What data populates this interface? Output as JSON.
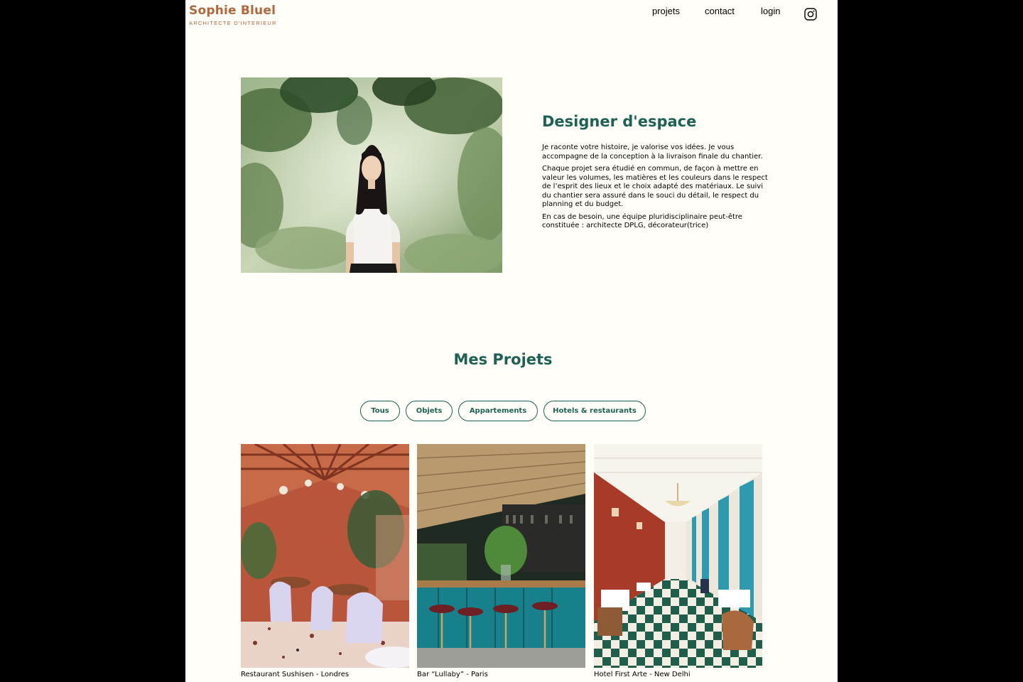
{
  "header": {
    "logo_title": "Sophie Bluel",
    "logo_subtitle": "ARCHITECTE D'INTERIEUR",
    "nav": {
      "projets": "projets",
      "contact": "contact",
      "login": "login"
    },
    "social_icon": "instagram-icon"
  },
  "intro": {
    "title": "Designer d'espace",
    "paragraphs": [
      "Je raconte votre histoire, je valorise vos idées. Je vous accompagne de la conception à la livraison finale du chantier.",
      "Chaque projet sera étudié en commun, de façon à mettre en valeur les volumes, les matières et les couleurs dans le respect de l’esprit des lieux et le choix adapté des matériaux. Le suivi du chantier sera assuré dans le souci du détail, le respect du planning et du budget.",
      "En cas de besoin, une équipe pluridisciplinaire peut-être constituée : architecte DPLG, décorateur(trice)"
    ]
  },
  "projects": {
    "title": "Mes Projets",
    "filters": [
      "Tous",
      "Objets",
      "Appartements",
      "Hotels & restaurants"
    ],
    "items": [
      {
        "caption": "Restaurant Sushisen - Londres"
      },
      {
        "caption": "Bar “Lullaby” - Paris"
      },
      {
        "caption": "Hotel First Arte - New Delhi"
      }
    ]
  },
  "colors": {
    "brand": "#B1663C",
    "accent": "#1D6154",
    "background": "#FFFEF8"
  }
}
